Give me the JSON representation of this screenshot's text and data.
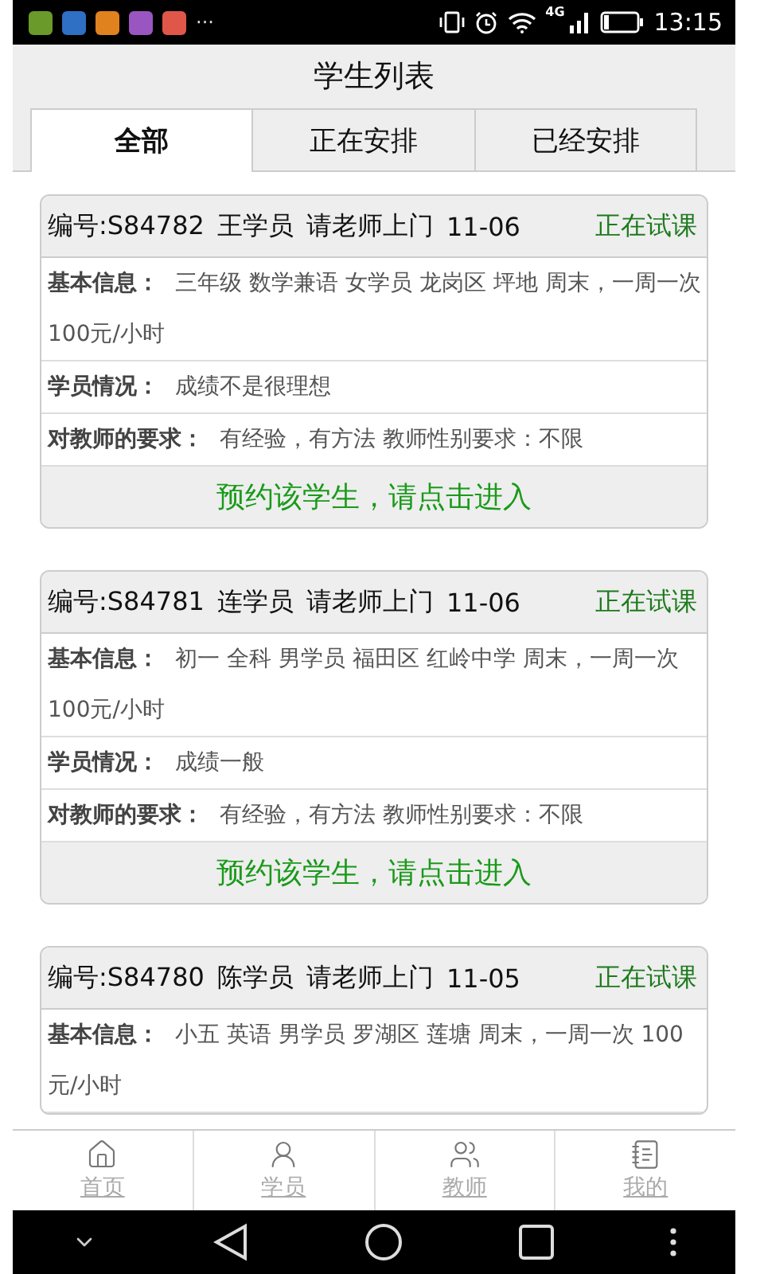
{
  "status_bar": {
    "notifications": [
      {
        "color": "#6a9a2a"
      },
      {
        "color": "#2f6fc4"
      },
      {
        "color": "#e0821e"
      },
      {
        "color": "#9a56c0"
      },
      {
        "color": "#e0574a"
      }
    ],
    "more": "···",
    "network": "4G",
    "time": "13:15"
  },
  "header": {
    "title": "学生列表"
  },
  "tabs": [
    {
      "label": "全部",
      "selected": true
    },
    {
      "label": "正在安排",
      "selected": false
    },
    {
      "label": "已经安排",
      "selected": false
    }
  ],
  "students": [
    {
      "number": "编号:S84782",
      "name": "王学员",
      "visit": "请老师上门",
      "date": "11-06",
      "status": "正在试课",
      "info_label": "基本信息：",
      "info": "三年级 数学兼语 女学员 龙岗区 坪地 周末，一周一次 100元/小时",
      "situation_label": "学员情况：",
      "situation": "成绩不是很理想",
      "req_label": "对教师的要求：",
      "requirement": "有经验，有方法  教师性别要求：不限",
      "action": "预约该学生，请点击进入"
    },
    {
      "number": "编号:S84781",
      "name": "连学员",
      "visit": "请老师上门",
      "date": "11-06",
      "status": "正在试课",
      "info_label": "基本信息：",
      "info": "初一 全科 男学员 福田区 红岭中学 周末，一周一次 100元/小时",
      "situation_label": "学员情况：",
      "situation": "成绩一般",
      "req_label": "对教师的要求：",
      "requirement": "有经验，有方法  教师性别要求：不限",
      "action": "预约该学生，请点击进入"
    },
    {
      "number": "编号:S84780",
      "name": "陈学员",
      "visit": "请老师上门",
      "date": "11-05",
      "status": "正在试课",
      "info_label": "基本信息：",
      "info": "小五 英语 男学员 罗湖区 莲塘 周末，一周一次 100元/小时"
    }
  ],
  "bottom_nav": [
    {
      "kind": "home",
      "label": "首页"
    },
    {
      "kind": "student",
      "label": "学员"
    },
    {
      "kind": "teacher",
      "label": "教师"
    },
    {
      "kind": "mine",
      "label": "我的"
    }
  ]
}
